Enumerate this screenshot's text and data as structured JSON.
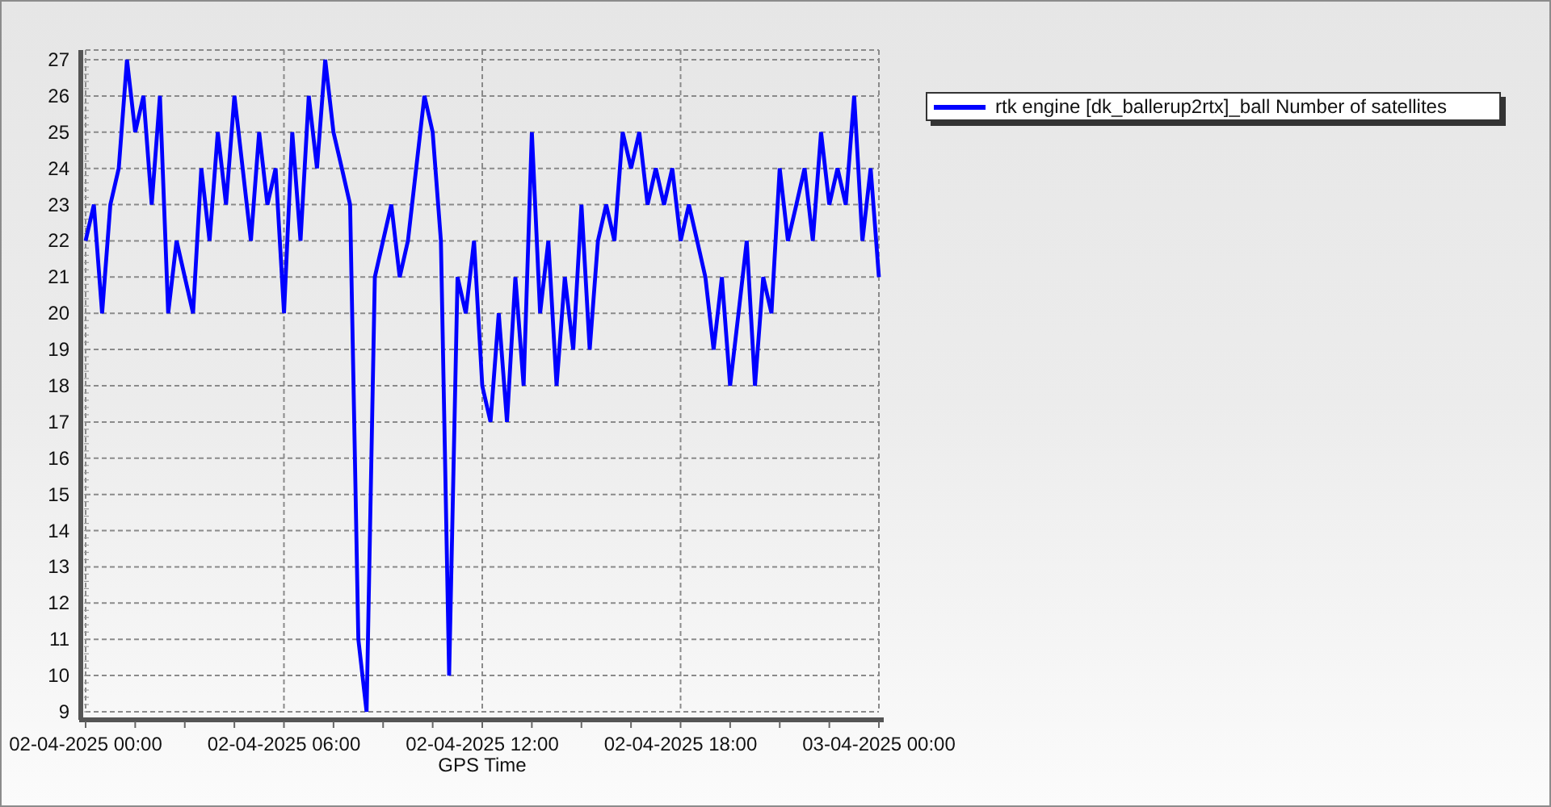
{
  "chart_data": {
    "type": "line",
    "xlabel": "GPS Time",
    "categories": [
      "02-04-2025 00:00",
      null,
      null,
      null,
      null,
      null,
      null,
      null,
      null,
      null,
      null,
      null,
      null,
      null,
      null,
      null,
      null,
      null,
      null,
      null,
      null,
      null,
      null,
      null,
      "02-04-2025 06:00",
      null,
      null,
      null,
      null,
      null,
      null,
      null,
      null,
      null,
      null,
      null,
      null,
      null,
      null,
      null,
      null,
      null,
      null,
      null,
      null,
      null,
      null,
      null,
      "02-04-2025 12:00",
      null,
      null,
      null,
      null,
      null,
      null,
      null,
      null,
      null,
      null,
      null,
      null,
      null,
      null,
      null,
      null,
      null,
      null,
      null,
      null,
      null,
      null,
      null,
      "02-04-2025 18:00",
      null,
      null,
      null,
      null,
      null,
      null,
      null,
      null,
      null,
      null,
      null,
      null,
      null,
      null,
      null,
      null,
      null,
      null,
      null,
      null,
      null,
      null,
      null,
      "03-04-2025 00:00"
    ],
    "series": [
      {
        "name": "rtk engine [dk_ballerup2rtx]_ball Number of satellites",
        "color": "#0000ff",
        "values": [
          22,
          23,
          20,
          23,
          24,
          27,
          25,
          26,
          23,
          26,
          20,
          22,
          21,
          20,
          24,
          22,
          25,
          23,
          26,
          24,
          22,
          25,
          23,
          24,
          20,
          25,
          22,
          26,
          24,
          27,
          25,
          24,
          23,
          11,
          9,
          21,
          22,
          23,
          21,
          22,
          24,
          26,
          25,
          22,
          10,
          21,
          20,
          22,
          18,
          17,
          20,
          17,
          21,
          18,
          25,
          20,
          22,
          18,
          21,
          19,
          23,
          19,
          22,
          23,
          22,
          25,
          24,
          25,
          23,
          24,
          23,
          24,
          22,
          23,
          22,
          21,
          19,
          21,
          18,
          20,
          22,
          18,
          21,
          20,
          24,
          22,
          23,
          24,
          22,
          25,
          23,
          24,
          23,
          26,
          22,
          24,
          21
        ]
      }
    ],
    "grid": true,
    "ylim": [
      9,
      27
    ],
    "yticks": [
      9,
      10,
      11,
      12,
      13,
      14,
      15,
      16,
      17,
      18,
      19,
      20,
      21,
      22,
      23,
      24,
      25,
      26,
      27
    ]
  }
}
